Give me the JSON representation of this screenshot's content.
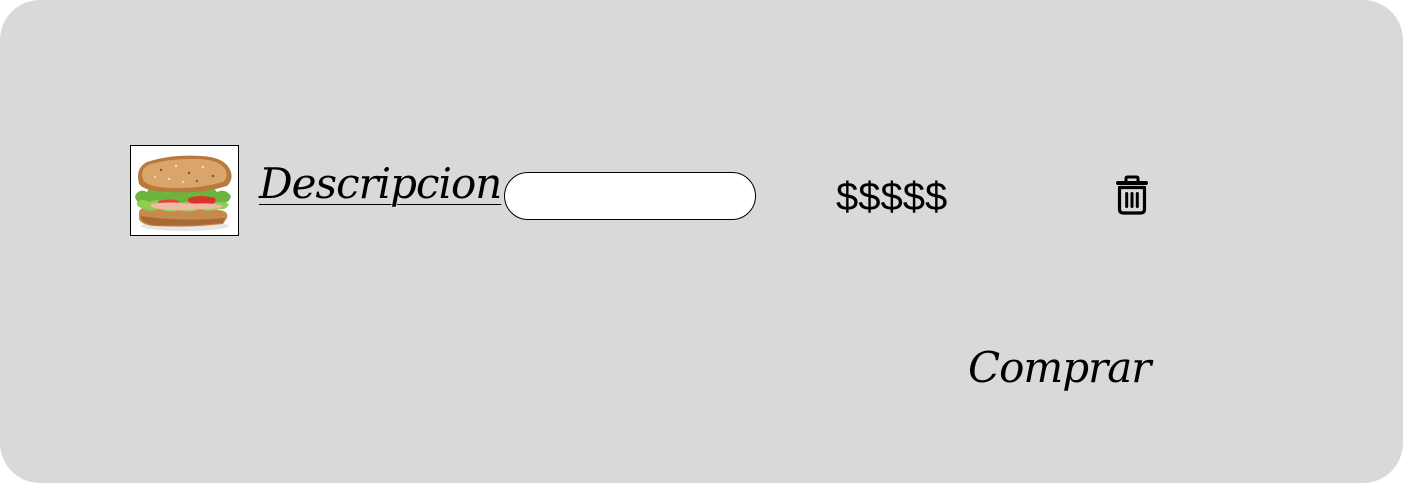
{
  "cart_item": {
    "image_alt": "sandwich",
    "description_link": "Descripcion",
    "quantity_value": "",
    "price": "$$$$$",
    "delete_icon": "trash-icon"
  },
  "actions": {
    "buy_label": "Comprar"
  },
  "colors": {
    "card_background": "#d9d9d9",
    "input_background": "#ffffff",
    "text": "#000000"
  }
}
